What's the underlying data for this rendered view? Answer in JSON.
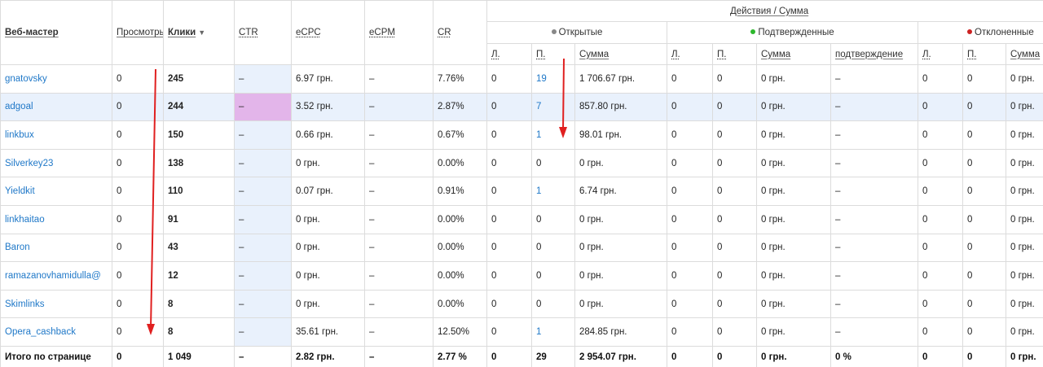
{
  "headers": {
    "webmaster": "Веб-мастер",
    "views": "Просмотры",
    "clicks": "Клики",
    "ctr": "CTR",
    "ecpc": "eCPC",
    "ecpm": "eCPM",
    "cr": "CR",
    "actions": "Действия / Сумма",
    "open": "Открытые",
    "confirmed": "Подтвержденные",
    "rejected": "Отклоненные",
    "l": "Л.",
    "p": "П.",
    "sum": "Сумма",
    "confirmation": "подтверждение"
  },
  "colors": {
    "open_dot": "#888888",
    "confirmed_dot": "#2db82d",
    "rejected_dot": "#cc2222",
    "link": "#1f78c8",
    "arrow": "#e02020",
    "highlight": "#e3b5ea"
  },
  "rows": [
    {
      "name": "gnatovsky",
      "views": "0",
      "clicks": "245",
      "ctr": "–",
      "ecpc": "6.97 грн.",
      "ecpm": "–",
      "cr": "7.76%",
      "o_l": "0",
      "o_p": "19",
      "o_sum": "1 706.67 грн.",
      "c_l": "0",
      "c_p": "0",
      "c_sum": "0 грн.",
      "c_conf": "–",
      "r_l": "0",
      "r_p": "0",
      "r_sum": "0 грн."
    },
    {
      "name": "adgoal",
      "views": "0",
      "clicks": "244",
      "ctr": "–",
      "ecpc": "3.52 грн.",
      "ecpm": "–",
      "cr": "2.87%",
      "o_l": "0",
      "o_p": "7",
      "o_sum": "857.80 грн.",
      "c_l": "0",
      "c_p": "0",
      "c_sum": "0 грн.",
      "c_conf": "–",
      "r_l": "0",
      "r_p": "0",
      "r_sum": "0 грн."
    },
    {
      "name": "linkbux",
      "views": "0",
      "clicks": "150",
      "ctr": "–",
      "ecpc": "0.66 грн.",
      "ecpm": "–",
      "cr": "0.67%",
      "o_l": "0",
      "o_p": "1",
      "o_sum": "98.01 грн.",
      "c_l": "0",
      "c_p": "0",
      "c_sum": "0 грн.",
      "c_conf": "–",
      "r_l": "0",
      "r_p": "0",
      "r_sum": "0 грн."
    },
    {
      "name": "Silverkey23",
      "views": "0",
      "clicks": "138",
      "ctr": "–",
      "ecpc": "0 грн.",
      "ecpm": "–",
      "cr": "0.00%",
      "o_l": "0",
      "o_p": "0",
      "o_sum": "0 грн.",
      "c_l": "0",
      "c_p": "0",
      "c_sum": "0 грн.",
      "c_conf": "–",
      "r_l": "0",
      "r_p": "0",
      "r_sum": "0 грн."
    },
    {
      "name": "Yieldkit",
      "views": "0",
      "clicks": "110",
      "ctr": "–",
      "ecpc": "0.07 грн.",
      "ecpm": "–",
      "cr": "0.91%",
      "o_l": "0",
      "o_p": "1",
      "o_sum": "6.74 грн.",
      "c_l": "0",
      "c_p": "0",
      "c_sum": "0 грн.",
      "c_conf": "–",
      "r_l": "0",
      "r_p": "0",
      "r_sum": "0 грн."
    },
    {
      "name": "linkhaitao",
      "views": "0",
      "clicks": "91",
      "ctr": "–",
      "ecpc": "0 грн.",
      "ecpm": "–",
      "cr": "0.00%",
      "o_l": "0",
      "o_p": "0",
      "o_sum": "0 грн.",
      "c_l": "0",
      "c_p": "0",
      "c_sum": "0 грн.",
      "c_conf": "–",
      "r_l": "0",
      "r_p": "0",
      "r_sum": "0 грн."
    },
    {
      "name": "Baron",
      "views": "0",
      "clicks": "43",
      "ctr": "–",
      "ecpc": "0 грн.",
      "ecpm": "–",
      "cr": "0.00%",
      "o_l": "0",
      "o_p": "0",
      "o_sum": "0 грн.",
      "c_l": "0",
      "c_p": "0",
      "c_sum": "0 грн.",
      "c_conf": "–",
      "r_l": "0",
      "r_p": "0",
      "r_sum": "0 грн."
    },
    {
      "name": "ramazanovhamidulla@",
      "views": "0",
      "clicks": "12",
      "ctr": "–",
      "ecpc": "0 грн.",
      "ecpm": "–",
      "cr": "0.00%",
      "o_l": "0",
      "o_p": "0",
      "o_sum": "0 грн.",
      "c_l": "0",
      "c_p": "0",
      "c_sum": "0 грн.",
      "c_conf": "–",
      "r_l": "0",
      "r_p": "0",
      "r_sum": "0 грн."
    },
    {
      "name": "Skimlinks",
      "views": "0",
      "clicks": "8",
      "ctr": "–",
      "ecpc": "0 грн.",
      "ecpm": "–",
      "cr": "0.00%",
      "o_l": "0",
      "o_p": "0",
      "o_sum": "0 грн.",
      "c_l": "0",
      "c_p": "0",
      "c_sum": "0 грн.",
      "c_conf": "–",
      "r_l": "0",
      "r_p": "0",
      "r_sum": "0 грн."
    },
    {
      "name": "Opera_cashback",
      "views": "0",
      "clicks": "8",
      "ctr": "–",
      "ecpc": "35.61 грн.",
      "ecpm": "–",
      "cr": "12.50%",
      "o_l": "0",
      "o_p": "1",
      "o_sum": "284.85 грн.",
      "c_l": "0",
      "c_p": "0",
      "c_sum": "0 грн.",
      "c_conf": "–",
      "r_l": "0",
      "r_p": "0",
      "r_sum": "0 грн."
    }
  ],
  "total": {
    "name": "Итого по странице",
    "views": "0",
    "clicks": "1 049",
    "ctr": "–",
    "ecpc": "2.82 грн.",
    "ecpm": "–",
    "cr": "2.77 %",
    "o_l": "0",
    "o_p": "29",
    "o_sum": "2 954.07 грн.",
    "c_l": "0",
    "c_p": "0",
    "c_sum": "0 грн.",
    "c_conf": "0 %",
    "r_l": "0",
    "r_p": "0",
    "r_sum": "0 грн."
  }
}
